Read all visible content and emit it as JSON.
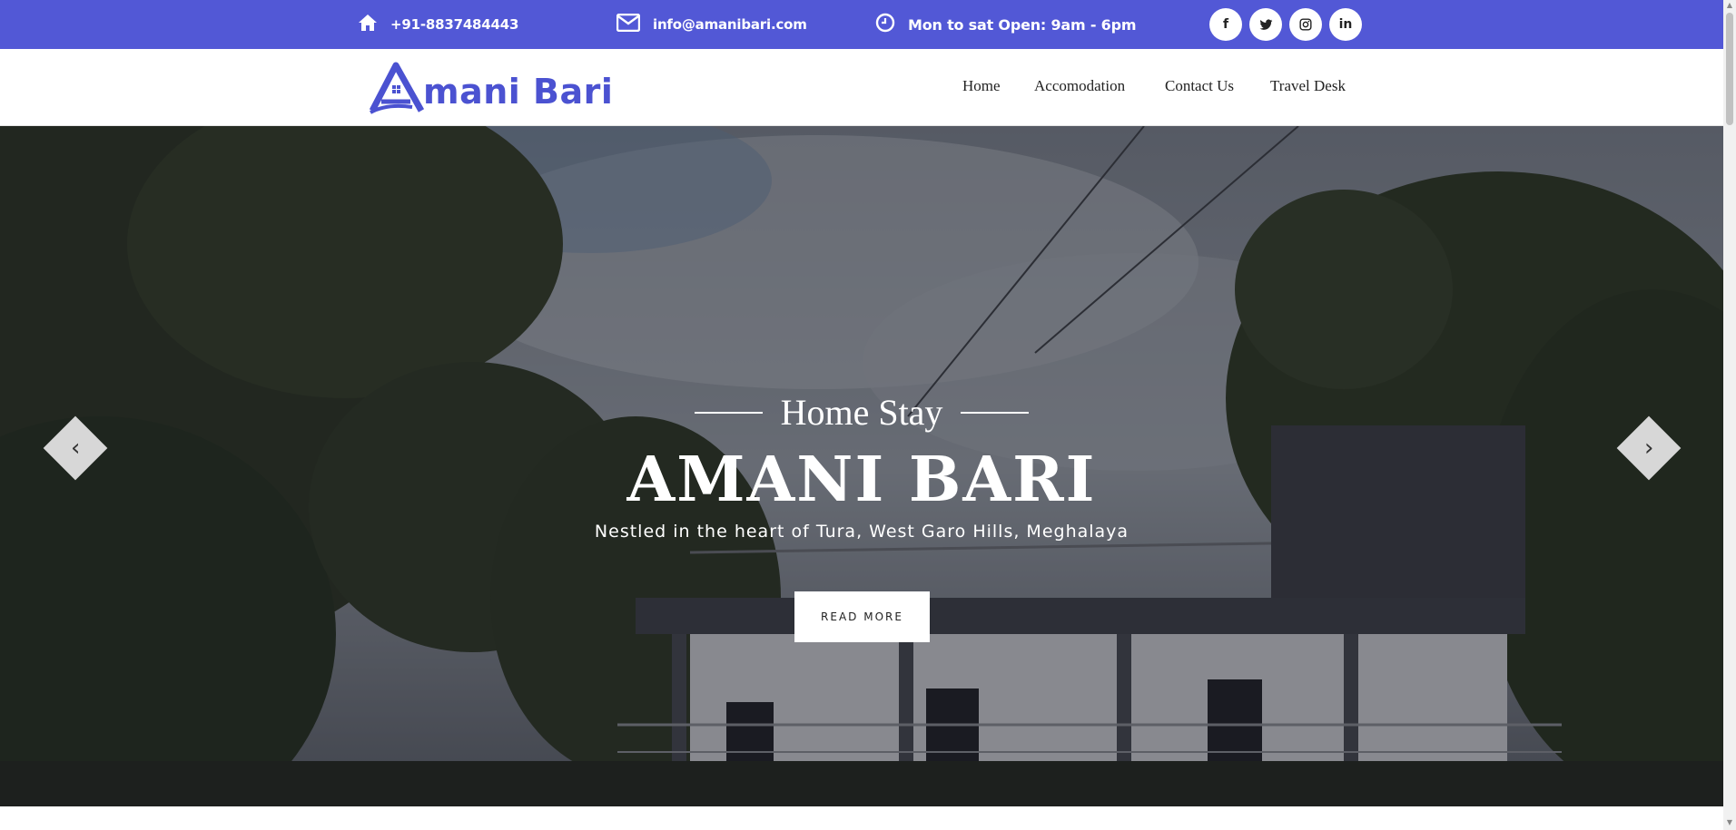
{
  "topbar": {
    "phone": "+91-8837484443",
    "email": "info@amanibari.com",
    "hours": "Mon to sat Open: 9am - 6pm",
    "icons": {
      "phone": "home-icon",
      "email": "envelope-icon",
      "hours": "clock-icon"
    },
    "social": [
      {
        "name": "facebook",
        "glyph": "f"
      },
      {
        "name": "twitter",
        "glyph": "t"
      },
      {
        "name": "instagram",
        "glyph": "◎"
      },
      {
        "name": "linkedin",
        "glyph": "in"
      }
    ],
    "bg_color": "#5258d6"
  },
  "brand": {
    "logo_text": "mani Bari",
    "logo_letter": "A",
    "color": "#4b52d1"
  },
  "nav": {
    "items": [
      "Home",
      "Accomodation",
      "Contact Us",
      "Travel Desk"
    ]
  },
  "hero": {
    "subtitle": "Home Stay",
    "title": "AMANI BARI",
    "description": "Nestled in the heart of Tura, West Garo Hills, Meghalaya",
    "button_label": "READ MORE",
    "prev_glyph": "‹",
    "next_glyph": "›"
  }
}
